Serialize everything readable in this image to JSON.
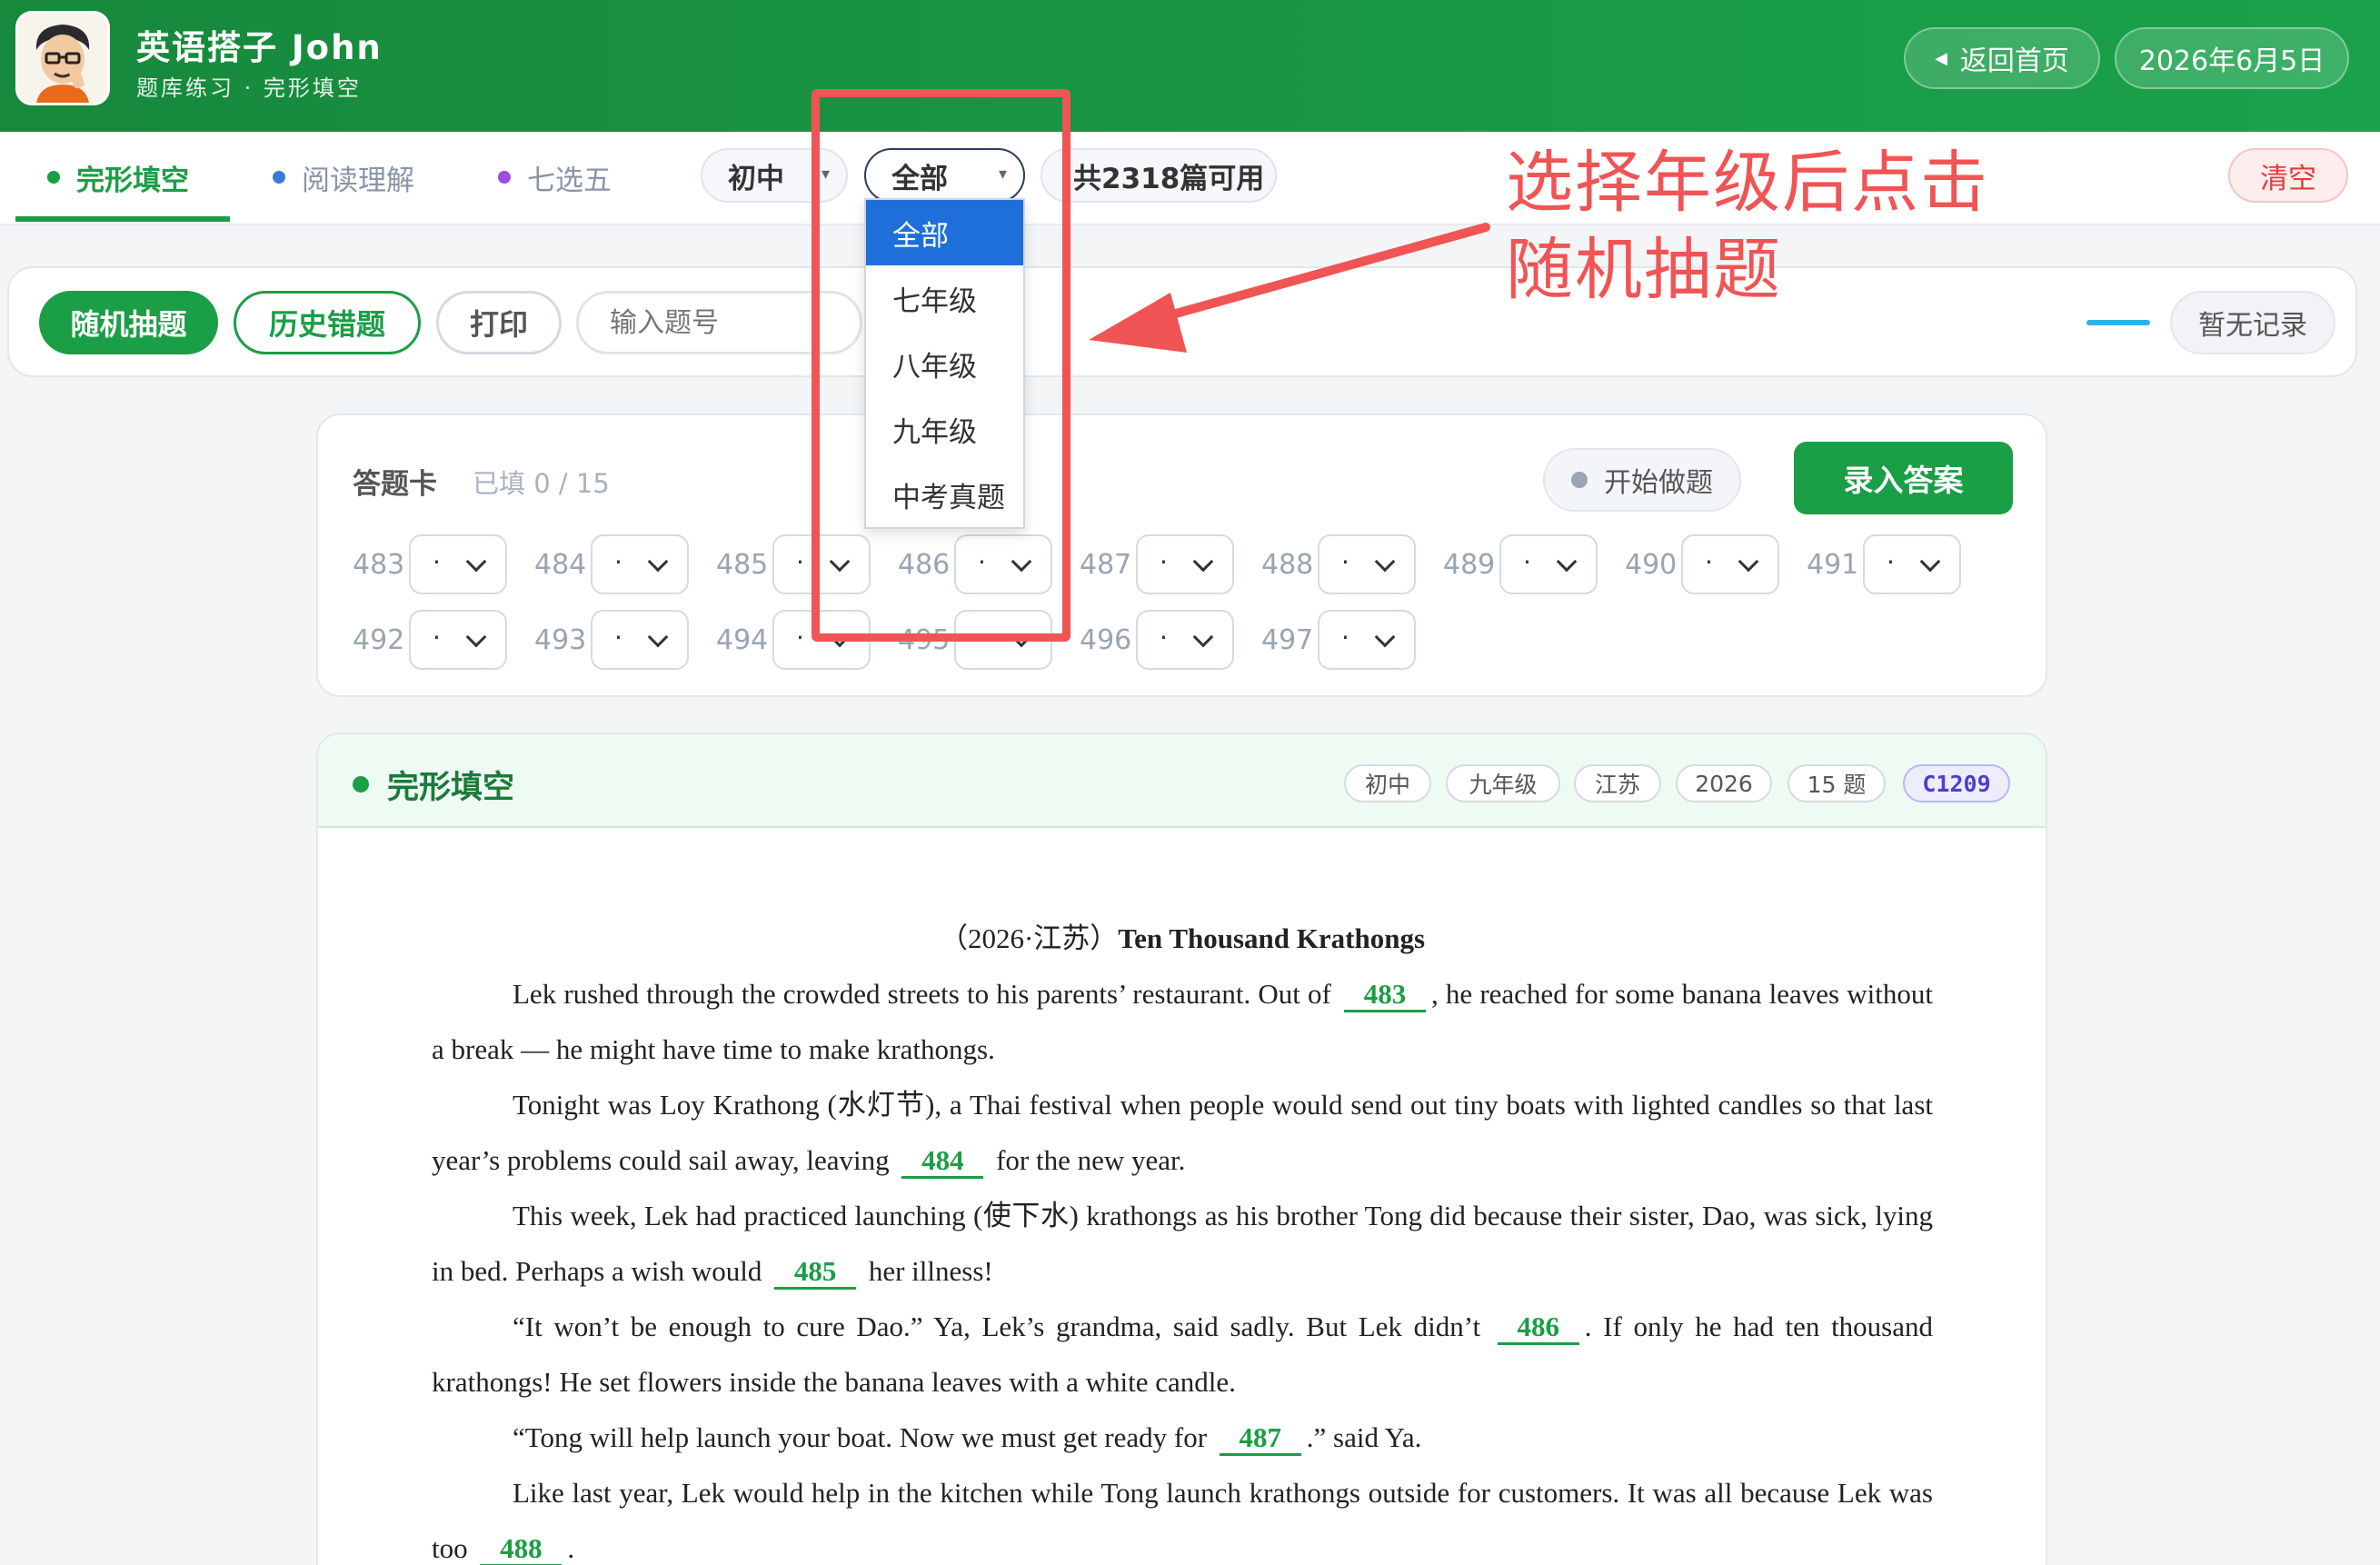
{
  "header": {
    "title": "英语搭子 John",
    "subtitle": "题库练习 · 完形填空",
    "back_label": "返回首页",
    "date": "2026年6月5日"
  },
  "tabs": [
    {
      "label": "完形填空",
      "color": "#1a9e46",
      "active": true
    },
    {
      "label": "阅读理解",
      "color": "#3a7bd5",
      "active": false
    },
    {
      "label": "七选五",
      "color": "#9b4ee0",
      "active": false
    }
  ],
  "filters": {
    "level": "初中",
    "grade": "全部",
    "count_text": "共2318篇可用",
    "clear_label": "清空"
  },
  "grade_options": [
    "全部",
    "七年级",
    "八年级",
    "九年级",
    "中考真题"
  ],
  "toolbar": {
    "random_label": "随机抽题",
    "history_label": "历史错题",
    "print_label": "打印",
    "input_placeholder": "输入题号",
    "no_record_label": "暂无记录"
  },
  "answer_card": {
    "title": "答题卡",
    "filled": "已填 0 / 15",
    "start_label": "开始做题",
    "record_label": "录入答案",
    "questions": [
      {
        "num": "483",
        "value": "·"
      },
      {
        "num": "484",
        "value": "·"
      },
      {
        "num": "485",
        "value": "·"
      },
      {
        "num": "486",
        "value": "·"
      },
      {
        "num": "487",
        "value": "·"
      },
      {
        "num": "488",
        "value": "·"
      },
      {
        "num": "489",
        "value": "·"
      },
      {
        "num": "490",
        "value": "·"
      },
      {
        "num": "491",
        "value": "·"
      },
      {
        "num": "492",
        "value": "·"
      },
      {
        "num": "493",
        "value": "·"
      },
      {
        "num": "494",
        "value": "·"
      },
      {
        "num": "495",
        "value": "·"
      },
      {
        "num": "496",
        "value": "·"
      },
      {
        "num": "497",
        "value": "·"
      }
    ]
  },
  "passage_card": {
    "title": "完形填空",
    "tags": [
      "初中",
      "九年级",
      "江苏",
      "2026",
      "15 题"
    ],
    "code": "C1209",
    "heading_prefix": "（2026·江苏）",
    "heading_title": "Ten Thousand Krathongs",
    "paragraphs": [
      [
        {
          "t": "Lek rushed through the crowded streets to his parents’ restaurant. Out of "
        },
        {
          "b": "483"
        },
        {
          "t": ", he reached for some banana leaves without a break — he might have time to make krathongs."
        }
      ],
      [
        {
          "t": "Tonight was Loy Krathong (水灯节), a Thai festival when people would send out tiny boats with lighted candles so that last year’s problems could sail away, leaving "
        },
        {
          "b": "484"
        },
        {
          "t": " for the new year."
        }
      ],
      [
        {
          "t": "This week, Lek had practiced launching (使下水) krathongs as his brother Tong did because their sister, Dao, was sick, lying in bed. Perhaps a wish would "
        },
        {
          "b": "485"
        },
        {
          "t": " her illness!"
        }
      ],
      [
        {
          "t": "“It won’t be enough to cure Dao.” Ya, Lek’s grandma, said sadly. But Lek didn’t "
        },
        {
          "b": "486"
        },
        {
          "t": ". If only he had ten thousand krathongs! He set flowers inside the banana leaves with a white candle."
        }
      ],
      [
        {
          "t": "“Tong will help launch your boat. Now we must get ready for "
        },
        {
          "b": "487"
        },
        {
          "t": ".” said Ya."
        }
      ],
      [
        {
          "t": "Like last year, Lek would help in the kitchen while Tong launch krathongs outside for customers. It was all because Lek was too "
        },
        {
          "b": "488"
        },
        {
          "t": "."
        }
      ]
    ]
  },
  "annotation": {
    "line1": "选择年级后点击",
    "line2": "随机抽题",
    "color": "#f05454"
  }
}
